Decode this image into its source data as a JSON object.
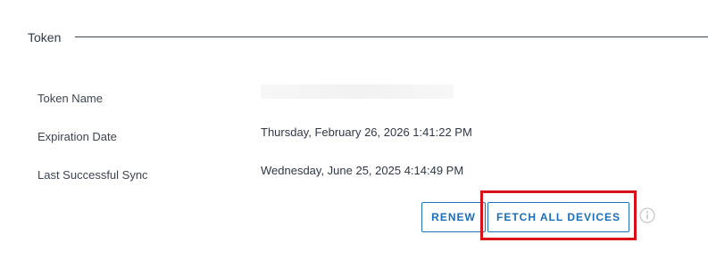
{
  "section": {
    "title": "Token"
  },
  "fields": {
    "token_name": {
      "label": "Token Name",
      "value": ""
    },
    "expiration_date": {
      "label": "Expiration Date",
      "value": "Thursday, February 26, 2026 1:41:22 PM"
    },
    "last_sync": {
      "label": "Last Successful Sync",
      "value": "Wednesday, June 25, 2025 4:14:49 PM"
    }
  },
  "actions": {
    "renew_label": "RENEW",
    "fetch_all_label": "FETCH ALL DEVICES"
  },
  "icons": {
    "info": "info-icon"
  },
  "colors": {
    "accent": "#1a73c0",
    "highlight": "#d9101a",
    "divider": "#3a4452"
  }
}
